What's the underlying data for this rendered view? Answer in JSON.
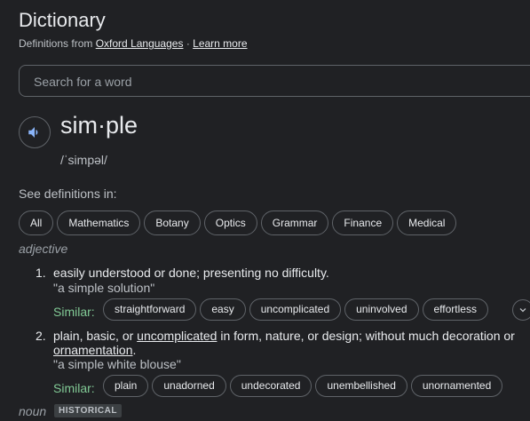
{
  "header": {
    "title": "Dictionary",
    "credits_prefix": "Definitions from",
    "source": "Oxford Languages",
    "separator": "·",
    "learn_more": "Learn more"
  },
  "search": {
    "placeholder": "Search for a word"
  },
  "entry": {
    "word": "sim·ple",
    "phonetic": "/ˈsimpəl/",
    "see_definitions_label": "See definitions in:",
    "domains": [
      "All",
      "Mathematics",
      "Botany",
      "Optics",
      "Grammar",
      "Finance",
      "Medical"
    ]
  },
  "adjective": {
    "pos": "adjective",
    "similar_label": "Similar:",
    "senses": [
      {
        "num": "1.",
        "definition": "easily understood or done; presenting no difficulty.",
        "example": "\"a simple solution\"",
        "similar": [
          "straightforward",
          "easy",
          "uncomplicated",
          "uninvolved",
          "effortless"
        ]
      },
      {
        "num": "2.",
        "def_before": "plain, basic, or ",
        "def_link1": "uncomplicated",
        "def_middle": " in form, nature, or design; without much decoration or ",
        "def_link2": "ornamentation",
        "def_end": ".",
        "example": "\"a simple white blouse\"",
        "similar": [
          "plain",
          "unadorned",
          "undecorated",
          "unembellished",
          "unornamented"
        ]
      }
    ]
  },
  "noun": {
    "pos": "noun",
    "tag": "HISTORICAL"
  },
  "icons": {
    "speaker": "speaker-icon",
    "expand": "chevron-down-icon"
  },
  "colors": {
    "background": "#202124",
    "similar_label": "#81c995",
    "speaker": "#8ab4f8"
  }
}
